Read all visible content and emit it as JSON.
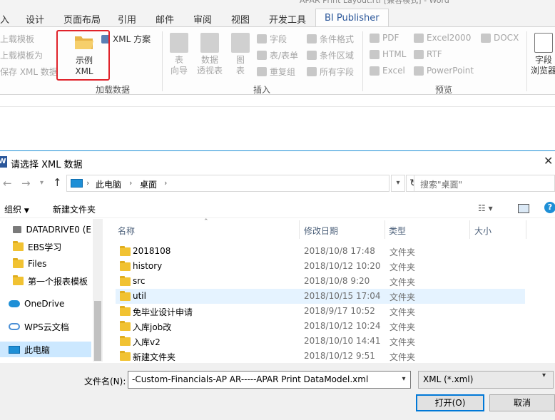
{
  "word": {
    "title": "APAR Print Layout.rtf [兼容模式] - Word",
    "tabs": [
      "入",
      "设计",
      "页面布局",
      "引用",
      "邮件",
      "审阅",
      "视图",
      "开发工具",
      "BI Publisher"
    ],
    "ribbon": {
      "upload_template": "上载模板",
      "upload_template_as": "上载模板为",
      "save_xml": "保存 XML 数据",
      "sample_xml": "示例\nXML",
      "xml_scheme": "XML 方案",
      "group_load": "加载数据",
      "table_wizard": "表\n向导",
      "pivot_table": "数据\n透视表",
      "chart": "图\n表",
      "field": "字段",
      "table_form": "表/表单",
      "repeat_group": "重复组",
      "conditional_format": "条件格式",
      "conditional_region": "条件区域",
      "all_fields": "所有字段",
      "group_insert": "插入",
      "pdf": "PDF",
      "html": "HTML",
      "excel": "Excel",
      "excel2000": "Excel2000",
      "rtf": "RTF",
      "powerpoint": "PowerPoint",
      "docx": "DOCX",
      "group_preview": "预览",
      "field_browser": "字段\n浏览器"
    }
  },
  "dialog": {
    "title": "请选择 XML 数据",
    "close": "✕",
    "path": [
      "此电脑",
      "桌面"
    ],
    "search_placeholder": "搜索\"桌面\"",
    "organize": "组织",
    "new_folder": "新建文件夹",
    "nav": [
      {
        "label": "DATADRIVE0 (E",
        "icon": "drive"
      },
      {
        "label": "EBS学习",
        "icon": "folder"
      },
      {
        "label": "Files",
        "icon": "folder"
      },
      {
        "label": "第一个报表模板",
        "icon": "folder"
      },
      {
        "label": "OneDrive",
        "icon": "cloud"
      },
      {
        "label": "WPS云文档",
        "icon": "wps"
      },
      {
        "label": "此电脑",
        "icon": "pc"
      }
    ],
    "columns": {
      "name": "名称",
      "date": "修改日期",
      "type": "类型",
      "size": "大小"
    },
    "files": [
      {
        "name": "2018108",
        "date": "2018/10/8 17:48",
        "type": "文件夹"
      },
      {
        "name": "history",
        "date": "2018/10/12 10:20",
        "type": "文件夹"
      },
      {
        "name": "src",
        "date": "2018/10/8 9:20",
        "type": "文件夹"
      },
      {
        "name": "util",
        "date": "2018/10/15 17:04",
        "type": "文件夹"
      },
      {
        "name": "免毕业设计申请",
        "date": "2018/9/17 10:52",
        "type": "文件夹"
      },
      {
        "name": "入库job改",
        "date": "2018/10/12 10:24",
        "type": "文件夹"
      },
      {
        "name": "入库v2",
        "date": "2018/10/10 14:41",
        "type": "文件夹"
      },
      {
        "name": "新建文件夹",
        "date": "2018/10/12 9:51",
        "type": "文件夹"
      }
    ],
    "filename_label": "文件名(N):",
    "filename_value": "-Custom-Financials-AP AR-----APAR Print DataModel.xml",
    "filetype": "XML (*.xml)",
    "open_button": "打开(O)",
    "cancel_button": "取消"
  }
}
